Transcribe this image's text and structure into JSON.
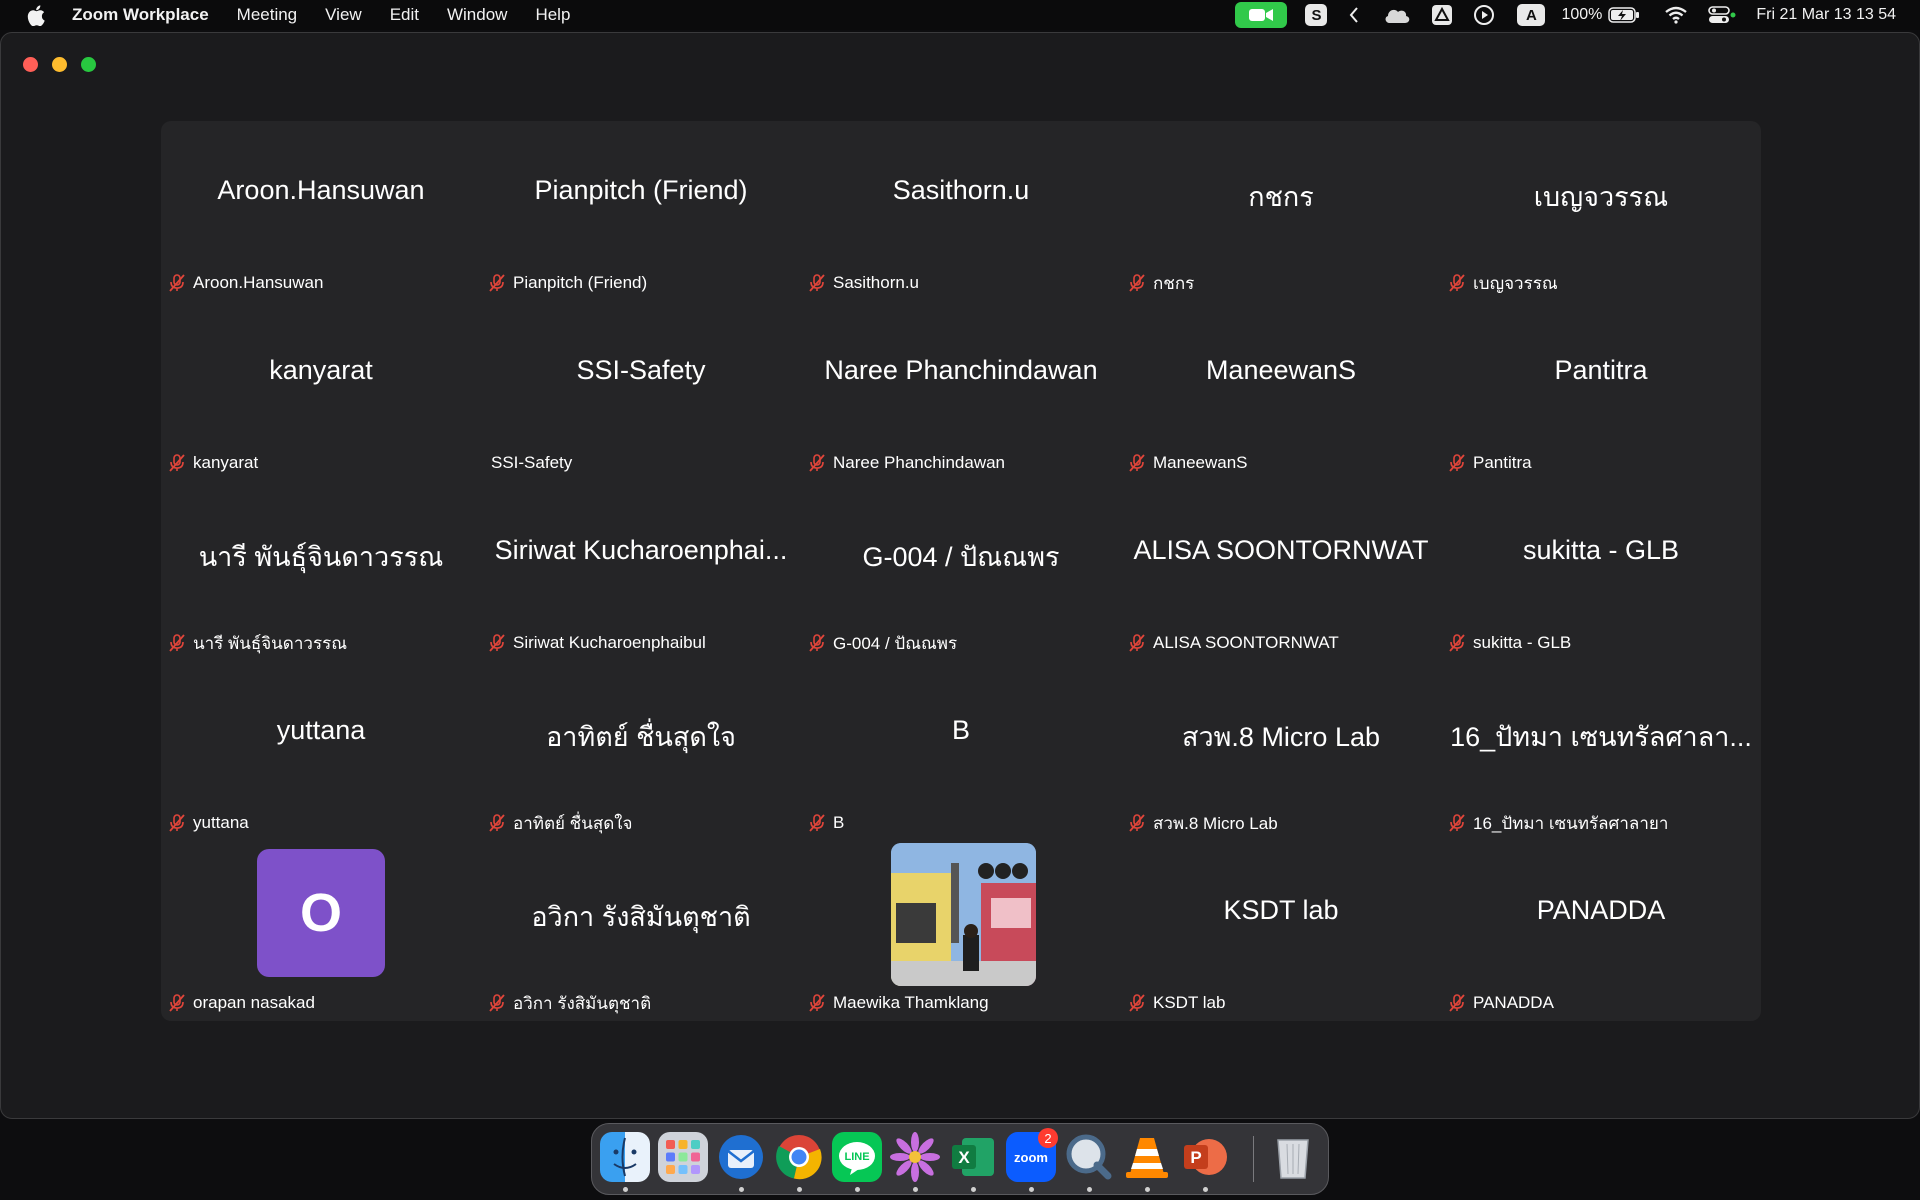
{
  "menubar": {
    "app_name": "Zoom Workplace",
    "menus": [
      "Meeting",
      "View",
      "Edit",
      "Window",
      "Help"
    ],
    "battery": "100%",
    "datetime": "Fri 21 Mar  13 13 54",
    "s_label": "S",
    "a_label": "A"
  },
  "participants": [
    {
      "display": "Aroon.Hansuwan",
      "label": "Aroon.Hansuwan",
      "muted": true
    },
    {
      "display": "Pianpitch (Friend)",
      "label": "Pianpitch (Friend)",
      "muted": true
    },
    {
      "display": "Sasithorn.u",
      "label": "Sasithorn.u",
      "muted": true
    },
    {
      "display": "กชกร",
      "label": "กชกร",
      "muted": true
    },
    {
      "display": "เบญจวรรณ",
      "label": "เบญจวรรณ",
      "muted": true
    },
    {
      "display": "kanyarat",
      "label": "kanyarat",
      "muted": true
    },
    {
      "display": "SSI-Safety",
      "label": "SSI-Safety",
      "muted": false
    },
    {
      "display": "Naree Phanchindawan",
      "label": "Naree Phanchindawan",
      "muted": true
    },
    {
      "display": "ManeewanS",
      "label": "ManeewanS",
      "muted": true
    },
    {
      "display": "Pantitra",
      "label": "Pantitra",
      "muted": true
    },
    {
      "display": "นารี พันธุ์จินดาวรรณ",
      "label": "นารี พันธุ์จินดาวรรณ",
      "muted": true
    },
    {
      "display": "Siriwat Kucharoenphai...",
      "label": "Siriwat Kucharoenphaibul",
      "muted": true
    },
    {
      "display": "G-004 / ปัณณพร",
      "label": "G-004 / ปัณณพร",
      "muted": true
    },
    {
      "display": "ALISA SOONTORNWAT",
      "label": "ALISA SOONTORNWAT",
      "muted": true
    },
    {
      "display": "sukitta - GLB",
      "label": "sukitta - GLB",
      "muted": true
    },
    {
      "display": "yuttana",
      "label": "yuttana",
      "muted": true
    },
    {
      "display": "อาทิตย์ ชื่นสุดใจ",
      "label": "อาทิตย์ ชื่นสุดใจ",
      "muted": true
    },
    {
      "display": "B",
      "label": "B",
      "muted": true
    },
    {
      "display": "สวพ.8 Micro Lab",
      "label": "สวพ.8 Micro Lab",
      "muted": true
    },
    {
      "display": "16_ปัทมา เซนทรัลศาลา...",
      "label": "16_ปัทมา เซนทรัลศาลายา",
      "muted": true
    },
    {
      "display": "",
      "label": "orapan nasakad",
      "muted": true,
      "avatar": "O"
    },
    {
      "display": "อวิกา รังสิมันตุชาติ",
      "label": "อวิกา รังสิมันตุชาติ",
      "muted": true
    },
    {
      "display": "",
      "label": "Maewika Thamklang",
      "muted": true,
      "photo": true
    },
    {
      "display": "KSDT lab",
      "label": "KSDT lab",
      "muted": true
    },
    {
      "display": "PANADDA",
      "label": "PANADDA",
      "muted": true
    }
  ],
  "dock": {
    "apps": [
      "Finder",
      "Launchpad",
      "Thunderbird",
      "Chrome",
      "LINE",
      "Flower",
      "Excel",
      "Zoom",
      "QuickTime",
      "VLC",
      "PowerPoint",
      "Trash"
    ],
    "zoom_badge": "2",
    "zoom_text": "zoom",
    "excel_letter": "X",
    "ppt_letter": "P",
    "line_text": "LINE"
  },
  "colors": {
    "avatar_purple": "#7e51c9",
    "mute_red": "#e0453a",
    "video_green": "#31c94a"
  }
}
